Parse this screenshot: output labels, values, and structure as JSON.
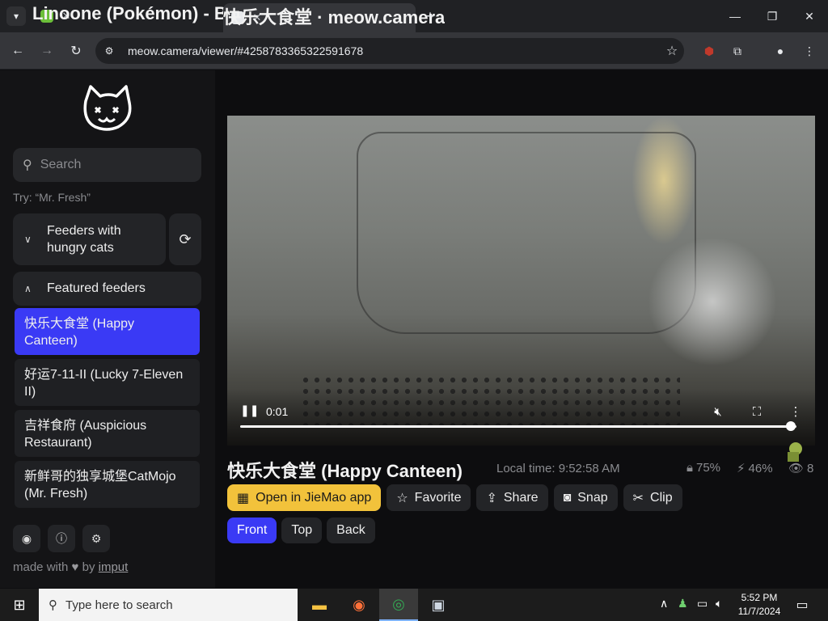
{
  "browser": {
    "tabs": [
      {
        "title": "Linoone (Pokémon) - Bulbapedi",
        "active": false
      },
      {
        "title": "快乐大食堂 · meow.camera",
        "active": true
      }
    ],
    "url": "meow.camera/viewer/#4258783365322591678"
  },
  "sidebar": {
    "search_placeholder": "Search",
    "try_hint": "Try: “Mr. Fresh”",
    "groups": [
      {
        "label": "Feeders with hungry cats",
        "expanded": false
      },
      {
        "label": "Featured feeders",
        "expanded": true
      }
    ],
    "feeders": [
      {
        "label": "快乐大食堂 (Happy Canteen)",
        "selected": true
      },
      {
        "label": "好运7-11-II (Lucky 7-Eleven II)",
        "selected": false
      },
      {
        "label": "吉祥食府 (Auspicious Restaurant)",
        "selected": false
      },
      {
        "label": "新鲜哥的独享城堡CatMojo (Mr. Fresh)",
        "selected": false
      }
    ],
    "made_with_prefix": "made with",
    "made_with_by": "by",
    "made_with_author": "imput"
  },
  "video": {
    "time": "0:01",
    "progress": 0.99
  },
  "feeder_info": {
    "title": "快乐大食堂 (Happy Canteen)",
    "local_time": "Local time: 9:52:58 AM",
    "stats": {
      "food": "75%",
      "battery": "46%",
      "viewers": "8"
    }
  },
  "actions": {
    "open_app": "Open in JieMao app",
    "favorite": "Favorite",
    "share": "Share",
    "snap": "Snap",
    "clip": "Clip"
  },
  "views": [
    "Front",
    "Top",
    "Back"
  ],
  "active_view": "Front",
  "taskbar": {
    "search_placeholder": "Type here to search",
    "time": "5:52 PM",
    "date": "11/7/2024"
  },
  "colors": {
    "accent": "#3a3af5",
    "primary_button": "#f2c23b"
  }
}
